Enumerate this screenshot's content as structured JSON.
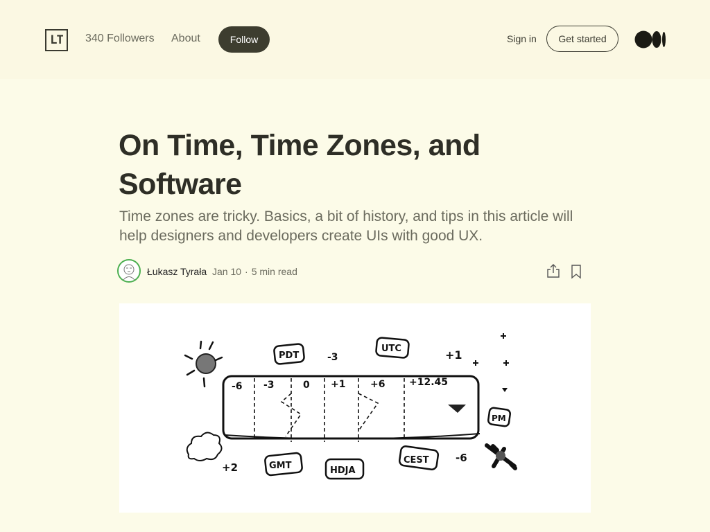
{
  "header": {
    "logo_text": "LT",
    "followers": "340 Followers",
    "about": "About",
    "follow": "Follow",
    "sign_in": "Sign in",
    "get_started": "Get started"
  },
  "article": {
    "title": "On Time, Time Zones, and Software",
    "subtitle": "Time zones are tricky. Basics, a bit of history, and tips in this article will help designers and developers create UIs with good UX.",
    "author": "Łukasz Tyrała",
    "date": "Jan 10",
    "read_time": "5 min read"
  },
  "illustration": {
    "top_labels": [
      "PDT",
      "-3",
      "UTC",
      "+1"
    ],
    "bar_labels": [
      "-6",
      "-3",
      "0",
      "+1",
      "+6",
      "+12.45"
    ],
    "right_label": "PM",
    "bottom_labels": [
      "+2",
      "GMT",
      "HDJA",
      "CEST",
      "-6"
    ]
  },
  "icons": {
    "share": "share-icon",
    "bookmark": "bookmark-icon",
    "medium_logo": "medium-logo-icon"
  }
}
